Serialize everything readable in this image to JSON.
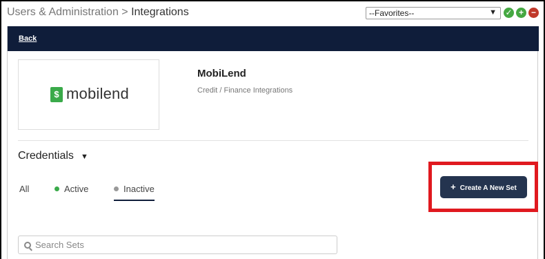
{
  "breadcrumb": {
    "section": "Users & Administration",
    "separator": " > ",
    "page": "Integrations"
  },
  "favorites": {
    "selected": "--Favorites--"
  },
  "toolbar": {
    "check_glyph": "✓",
    "plus_glyph": "+",
    "minus_glyph": "−"
  },
  "nav": {
    "back_label": "Back"
  },
  "integration": {
    "name": "MobiLend",
    "category": "Credit / Finance Integrations",
    "logo_text": "mobilend",
    "logo_mark": "$"
  },
  "credentials": {
    "title": "Credentials",
    "tabs": [
      {
        "label": "All"
      },
      {
        "label": "Active"
      },
      {
        "label": "Inactive"
      }
    ],
    "create_button": "Create A New Set",
    "search_placeholder": "Search Sets"
  },
  "colors": {
    "header": "#0f1d3a",
    "button": "#24344f",
    "highlight": "#e0191f",
    "green": "#3aaa4a"
  },
  "icons": [
    "check-icon",
    "plus-icon",
    "minus-icon",
    "chevron-down-icon",
    "search-icon"
  ]
}
